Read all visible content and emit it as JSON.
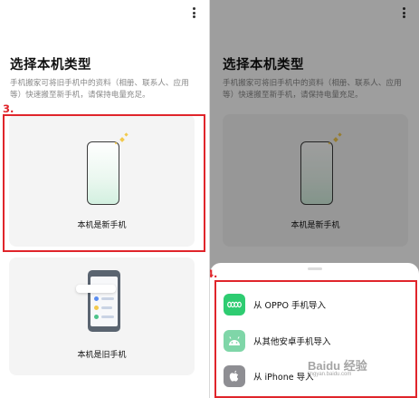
{
  "left": {
    "title": "选择本机类型",
    "description": "手机搬家可将旧手机中的资料（相册、联系人、应用等）快速搬至新手机，请保持电量充足。",
    "cards": [
      {
        "label": "本机是新手机"
      },
      {
        "label": "本机是旧手机"
      }
    ],
    "annotation": "3."
  },
  "right": {
    "title": "选择本机类型",
    "description": "手机搬家可将旧手机中的资料（相册、联系人、应用等）快速搬至新手机，请保持电量充足。",
    "card_label": "本机是新手机",
    "annotation": "4.",
    "sheet": {
      "options": [
        {
          "label": "从 OPPO 手机导入",
          "icon": "oppo-logo-icon",
          "color": "#2ecc71"
        },
        {
          "label": "从其他安卓手机导入",
          "icon": "android-icon",
          "color": "#7fd6a8"
        },
        {
          "label": "从 iPhone 导入",
          "icon": "apple-icon",
          "color": "#8e8e93"
        }
      ]
    }
  },
  "watermark": {
    "main": "Baidu 经验",
    "sub": "jingyan.baidu.com"
  },
  "colors": {
    "annotation": "#e0252b",
    "accent": "#2ecc71"
  }
}
